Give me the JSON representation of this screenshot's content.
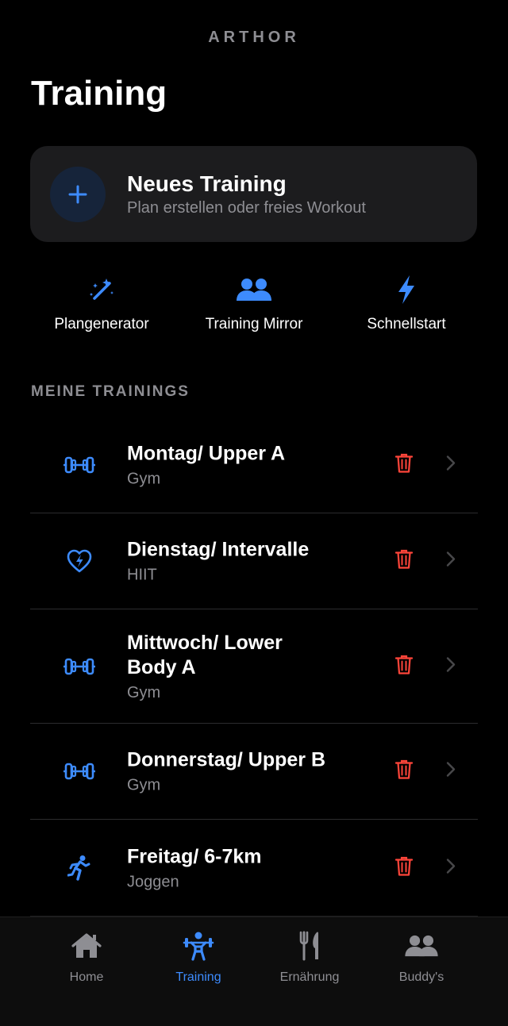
{
  "brand": "ARTHOR",
  "page_title": "Training",
  "new_training": {
    "title": "Neues Training",
    "subtitle": "Plan erstellen oder freies Workout",
    "icon": "plus-icon"
  },
  "quick_actions": [
    {
      "label": "Plangenerator",
      "icon": "magic-wand-icon"
    },
    {
      "label": "Training Mirror",
      "icon": "people-icon"
    },
    {
      "label": "Schnellstart",
      "icon": "bolt-icon"
    }
  ],
  "section_title": "MEINE TRAININGS",
  "trainings": [
    {
      "name": "Montag/ Upper A",
      "type": "Gym",
      "icon": "dumbbell-icon"
    },
    {
      "name": "Dienstag/ Intervalle",
      "type": "HIIT",
      "icon": "heart-bolt-icon"
    },
    {
      "name": "Mittwoch/ Lower Body A",
      "type": "Gym",
      "icon": "dumbbell-icon"
    },
    {
      "name": "Donnerstag/ Upper B",
      "type": "Gym",
      "icon": "dumbbell-icon"
    },
    {
      "name": "Freitag/ 6-7km",
      "type": "Joggen",
      "icon": "runner-icon"
    }
  ],
  "tabs": [
    {
      "label": "Home",
      "icon": "home-icon",
      "active": false
    },
    {
      "label": "Training",
      "icon": "weightlifter-icon",
      "active": true
    },
    {
      "label": "Ernährung",
      "icon": "fork-knife-icon",
      "active": false
    },
    {
      "label": "Buddy's",
      "icon": "people-icon",
      "active": false
    }
  ],
  "colors": {
    "accent": "#3d8bfd",
    "danger": "#ff453a",
    "background": "#000000",
    "card": "#1c1c1e",
    "muted": "#8e8e93"
  }
}
